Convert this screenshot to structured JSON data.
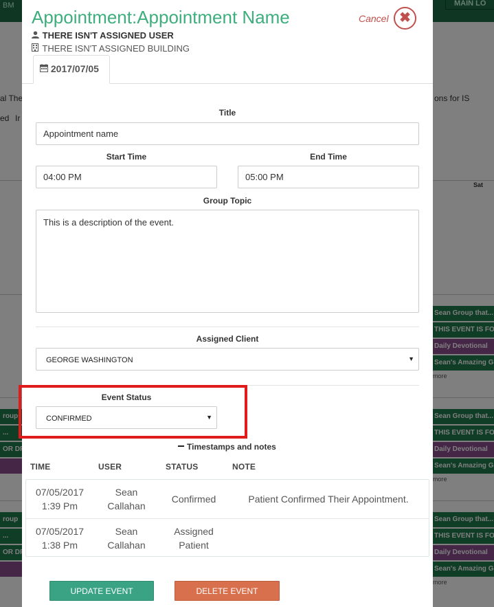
{
  "background": {
    "top_label": "BM",
    "main_button": "MAIN LO",
    "texts": [
      "al Ther",
      "ons for IS",
      "ed",
      "Ir",
      "Sat"
    ],
    "events": [
      "Sean Group that...",
      "THIS EVENT IS FOR",
      "Daily Devotional",
      "Sean's Amazing G",
      "more",
      "roup",
      "...",
      "OR DR",
      "Sean Group that...",
      "THIS EVENT IS FO",
      "Daily Devotional",
      "Sean's Amazing G",
      "more",
      "roup",
      "...",
      "OR DR",
      "Sean Group that...",
      "THIS EVENT IS FO",
      "Daily Devotional",
      "Sean's Amazing G",
      "more"
    ]
  },
  "modal": {
    "title": "Appointment:Appointment Name",
    "cancel_label": "Cancel",
    "close_glyph": "✖",
    "assigned_user": "THERE ISN'T ASSIGNED USER",
    "assigned_building": "THERE ISN'T ASSIGNED BUILDING",
    "date_tab": "2017/07/05"
  },
  "form": {
    "title_label": "Title",
    "title_value": "Appointment name",
    "start_label": "Start Time",
    "start_value": "04:00 PM",
    "end_label": "End Time",
    "end_value": "05:00 PM",
    "topic_label": "Group Topic",
    "topic_value": "This is a description of the event.",
    "client_label": "Assigned Client",
    "client_value": "GEORGE WASHINGTON",
    "status_label": "Event Status",
    "status_value": "CONFIRMED"
  },
  "timestamps": {
    "toggle_label": "Timestamps and notes",
    "headers": [
      "TIME",
      "USER",
      "STATUS",
      "NOTE"
    ],
    "rows": [
      {
        "date": "07/05/2017",
        "time": "1:39 Pm",
        "user_first": "Sean",
        "user_last": "Callahan",
        "status": "Confirmed",
        "status2": "",
        "note": "Patient Confirmed Their Appointment."
      },
      {
        "date": "07/05/2017",
        "time": "1:38 Pm",
        "user_first": "Sean",
        "user_last": "Callahan",
        "status": "Assigned",
        "status2": "Patient",
        "note": ""
      }
    ]
  },
  "actions": {
    "update_label": "UPDATE EVENT",
    "delete_label": "DELETE EVENT"
  },
  "colors": {
    "accent": "#3fae7d",
    "danger": "#c0504d",
    "highlight": "#e01b1b",
    "update_button": "#3aa384",
    "delete_button": "#d9704d"
  },
  "icons": [
    "user-icon",
    "building-icon",
    "calendar-icon",
    "close-icon",
    "caret-down-icon",
    "minus-icon"
  ]
}
